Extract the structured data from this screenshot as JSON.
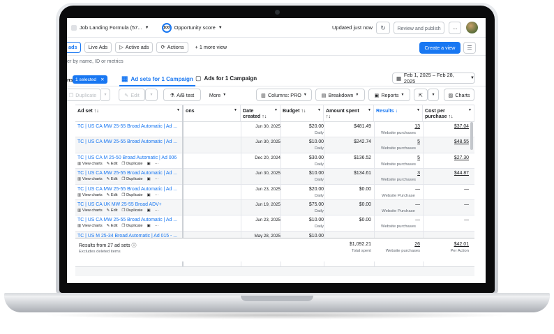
{
  "header": {
    "account": "Job Landing Formula (57...",
    "opportunity_badge": "100",
    "opportunity": "Opportunity score",
    "updated": "Updated just now",
    "review_publish": "Review and publish",
    "more": "···"
  },
  "nav": {
    "ads_tab": "ads",
    "live_ads": "Live Ads",
    "active_ads": "Active ads",
    "actions": "Actions",
    "more_view": "+ 1 more view",
    "create_view": "Create a view"
  },
  "search": {
    "placeholder": "er by name, ID or metrics"
  },
  "tabs": {
    "left_fragment": "ns",
    "selected": "1 selected",
    "adsets": "Ad sets for 1 Campaign",
    "ads": "Ads for 1 Campaign",
    "date_range": "Feb 1, 2025 – Feb 28, 2025"
  },
  "toolbar": {
    "duplicate": "Duplicate",
    "edit": "Edit",
    "ab_test": "A/B test",
    "more": "More",
    "columns": "Columns: PRO",
    "breakdown": "Breakdown",
    "reports": "Reports",
    "charts": "Charts"
  },
  "columns": {
    "ad_set": "Ad set ↑↓",
    "ons": "ons",
    "date_created": "Date created ↑↓",
    "budget": "Budget ↑↓",
    "amount_spent": "Amount spent ↑↓",
    "results": "Results ↓",
    "cost_per_purchase": "Cost per purchase ↑↓"
  },
  "row_actions": {
    "view_charts": "View charts",
    "edit": "Edit",
    "duplicate": "Duplicate",
    "more": "···"
  },
  "rows": [
    {
      "name": "TC | US CA MW 25-55 Broad Automatic | Ad ...",
      "date": "Jun 30, 2025",
      "budget": "$20.00",
      "budget_type": "Daily",
      "spent": "$481.49",
      "results": "13",
      "results_type": "Website purchases",
      "cost": "$37.04"
    },
    {
      "name": "TC | US CA MW 25-55 Broad Automatic | Ad ...",
      "date": "Jun 30, 2025",
      "budget": "$10.00",
      "budget_type": "Daily",
      "spent": "$242.74",
      "results": "5",
      "results_type": "Website purchases",
      "cost": "$48.55"
    },
    {
      "name": "TC | US CA M 25-50 Broad Automatic | Ad 006",
      "date": "Dec 20, 2024",
      "budget": "$30.00",
      "budget_type": "Daily",
      "spent": "$136.52",
      "results": "5",
      "results_type": "Website purchases",
      "cost": "$27.30"
    },
    {
      "name": "TC | US CA MW 25-55 Broad Automatic | Ad ...",
      "date": "Jun 30, 2025",
      "budget": "$10.00",
      "budget_type": "Daily",
      "spent": "$134.61",
      "results": "3",
      "results_type": "Website purchases",
      "cost": "$44.87"
    },
    {
      "name": "TC | US CA MW 25-55 Broad Automatic | Ad ...",
      "date": "Jun 23, 2025",
      "budget": "$20.00",
      "budget_type": "Daily",
      "spent": "$0.00",
      "results": "—",
      "results_type": "Website Purchase",
      "cost": "—"
    },
    {
      "name": "TC | US CA UK MW 25-55 Broad ADV+",
      "date": "Jun 19, 2025",
      "budget": "$75.00",
      "budget_type": "Daily",
      "spent": "$0.00",
      "results": "—",
      "results_type": "Website Purchase",
      "cost": "—"
    },
    {
      "name": "TC | US CA MW 25-55 Broad Automatic | Ad ...",
      "date": "Jun 23, 2025",
      "budget": "$10.00",
      "budget_type": "Daily",
      "spent": "$0.00",
      "results": "—",
      "results_type": "Website purchases",
      "cost": "—"
    },
    {
      "name": "TC | US M 25-34 Broad Automatic | Ad 015 - ...",
      "date": "May 28, 2025",
      "budget": "$10.00",
      "budget_type": "",
      "spent": "",
      "results": "",
      "results_type": "",
      "cost": ""
    }
  ],
  "footer": {
    "results_from": "Results from 27 ad sets",
    "excludes": "Excludes deleted items",
    "total_spent": "$1,092.21",
    "total_spent_label": "Total spent",
    "total_results": "26",
    "total_results_label": "Website purchases",
    "total_cost": "$42.01",
    "total_cost_label": "Per Action"
  },
  "colors": {
    "accent": "#1877f2",
    "border": "#ccd0d5"
  }
}
